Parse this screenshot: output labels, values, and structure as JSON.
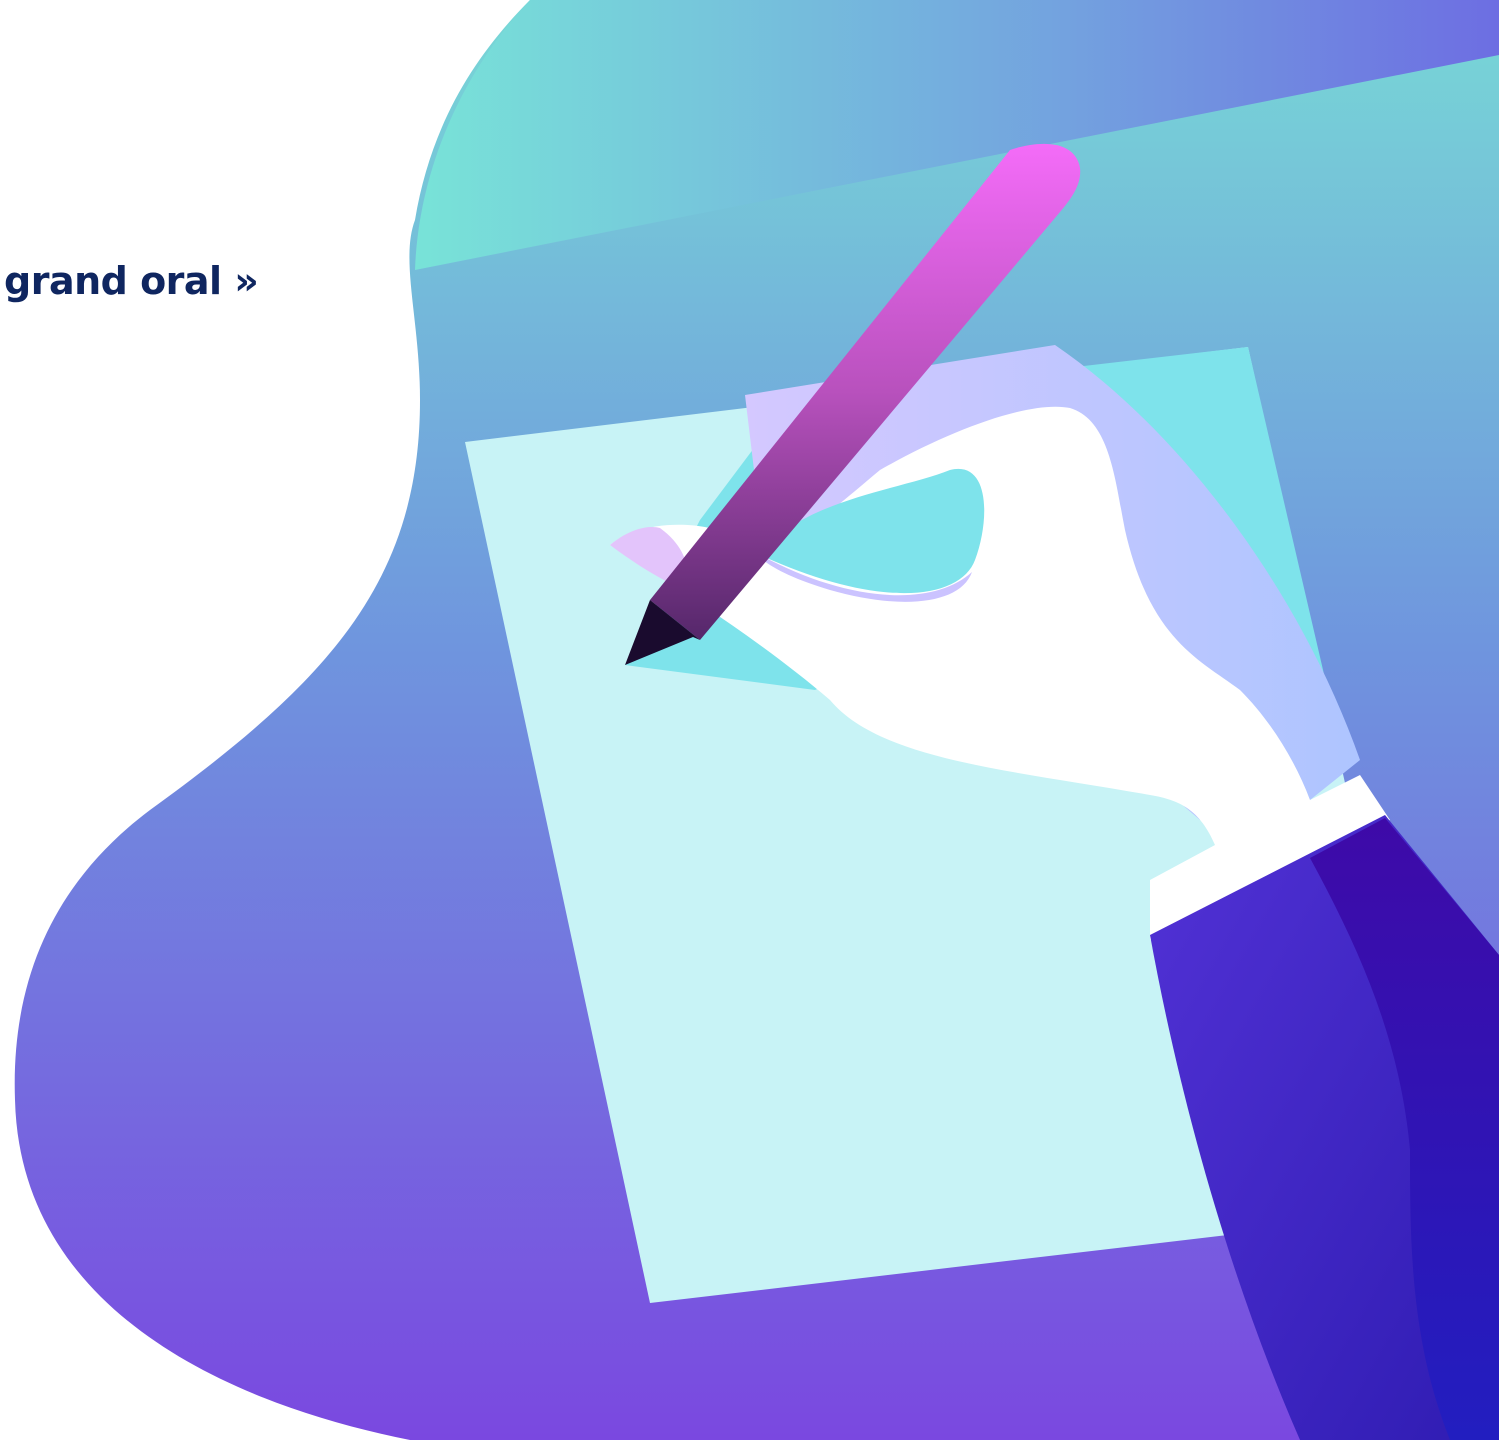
{
  "heading": {
    "text": "grand oral »"
  },
  "colors": {
    "heading": "#0f2660",
    "blob_top": "#78e3d8",
    "blob_bottom": "#7a48e0",
    "paper_light": "#c8f3f6",
    "paper_accent": "#7ee3eb",
    "pen_top": "#f46cf8",
    "pen_bottom": "#5a2a6e",
    "sleeve_dark": "#2a1bbf",
    "sleeve_mid": "#4b2ad0"
  },
  "illustration": {
    "icon": "hand-writing-with-pen-icon"
  }
}
